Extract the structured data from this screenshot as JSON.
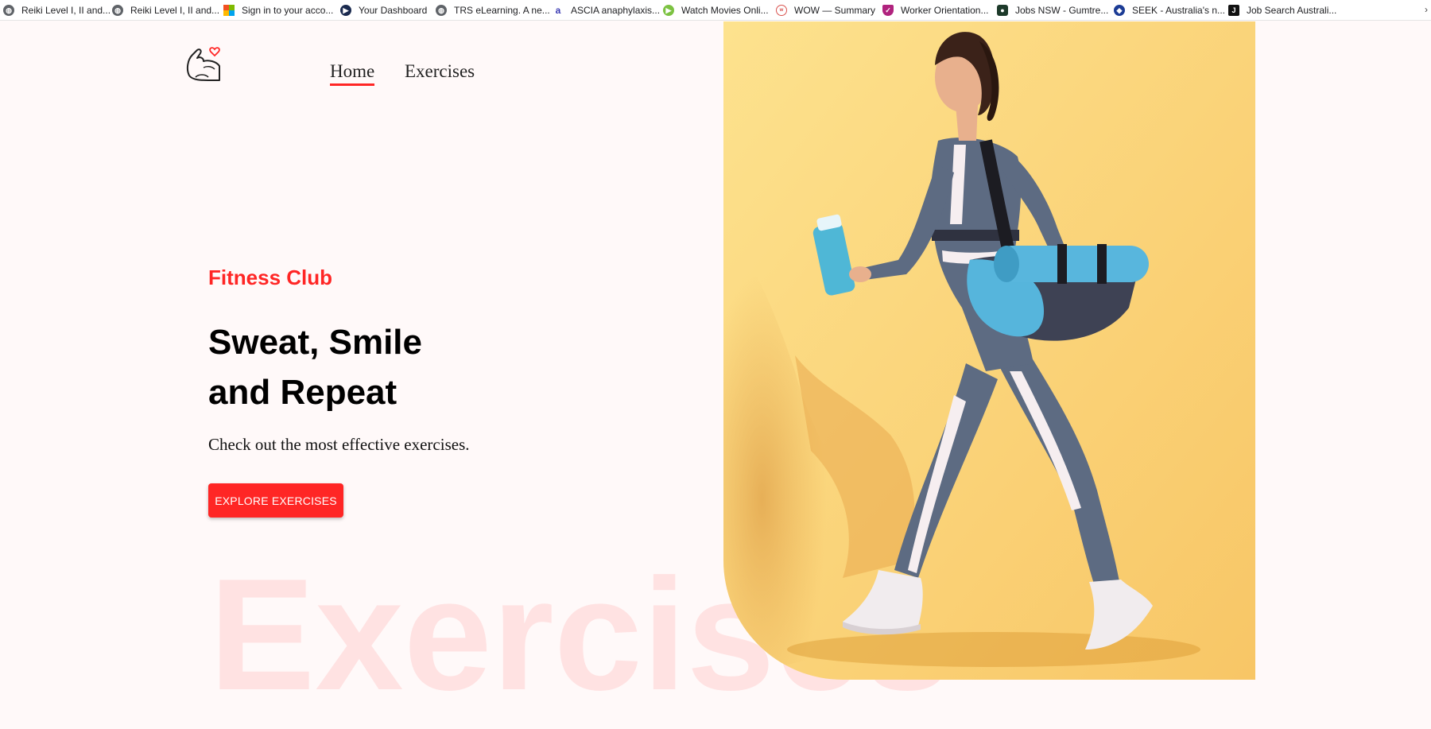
{
  "bookmarks": [
    {
      "label": "Reiki Level I, II and...",
      "icon": "globe-icon",
      "color": "#5f6368"
    },
    {
      "label": "Reiki Level I, II and...",
      "icon": "globe-icon",
      "color": "#5f6368"
    },
    {
      "label": "Sign in to your acco...",
      "icon": "microsoft-icon",
      "color": "#f25022"
    },
    {
      "label": "Your Dashboard",
      "icon": "play-circle-icon",
      "color": "#1a2a4f"
    },
    {
      "label": "TRS eLearning. A ne...",
      "icon": "globe-icon",
      "color": "#5f6368"
    },
    {
      "label": "ASCIA anaphylaxis...",
      "icon": "ascia-icon",
      "color": "#3b3bb3"
    },
    {
      "label": "Watch Movies Onli...",
      "icon": "play-circle-icon",
      "color": "#7cc242"
    },
    {
      "label": "WOW — Summary",
      "icon": "wow-icon",
      "color": "#d9534f"
    },
    {
      "label": "Worker Orientation...",
      "icon": "shield-icon",
      "color": "#b0237e"
    },
    {
      "label": "Jobs NSW - Gumtre...",
      "icon": "gumtree-icon",
      "color": "#1d3a2a"
    },
    {
      "label": "SEEK - Australia's n...",
      "icon": "seek-icon",
      "color": "#1c3c95"
    },
    {
      "label": "Job Search Australi...",
      "icon": "jora-icon",
      "color": "#111111"
    }
  ],
  "nav": {
    "home": "Home",
    "exercises": "Exercises"
  },
  "hero": {
    "brand": "Fitness Club",
    "headline_line1": "Sweat, Smile",
    "headline_line2": "and Repeat",
    "tagline": "Check out the most effective exercises.",
    "cta": "EXPLORE EXERCISES",
    "watermark": "Exercises"
  },
  "colors": {
    "accent": "#ff2625",
    "background": "#fff9f9",
    "hero_bg": "#fbd67c"
  }
}
